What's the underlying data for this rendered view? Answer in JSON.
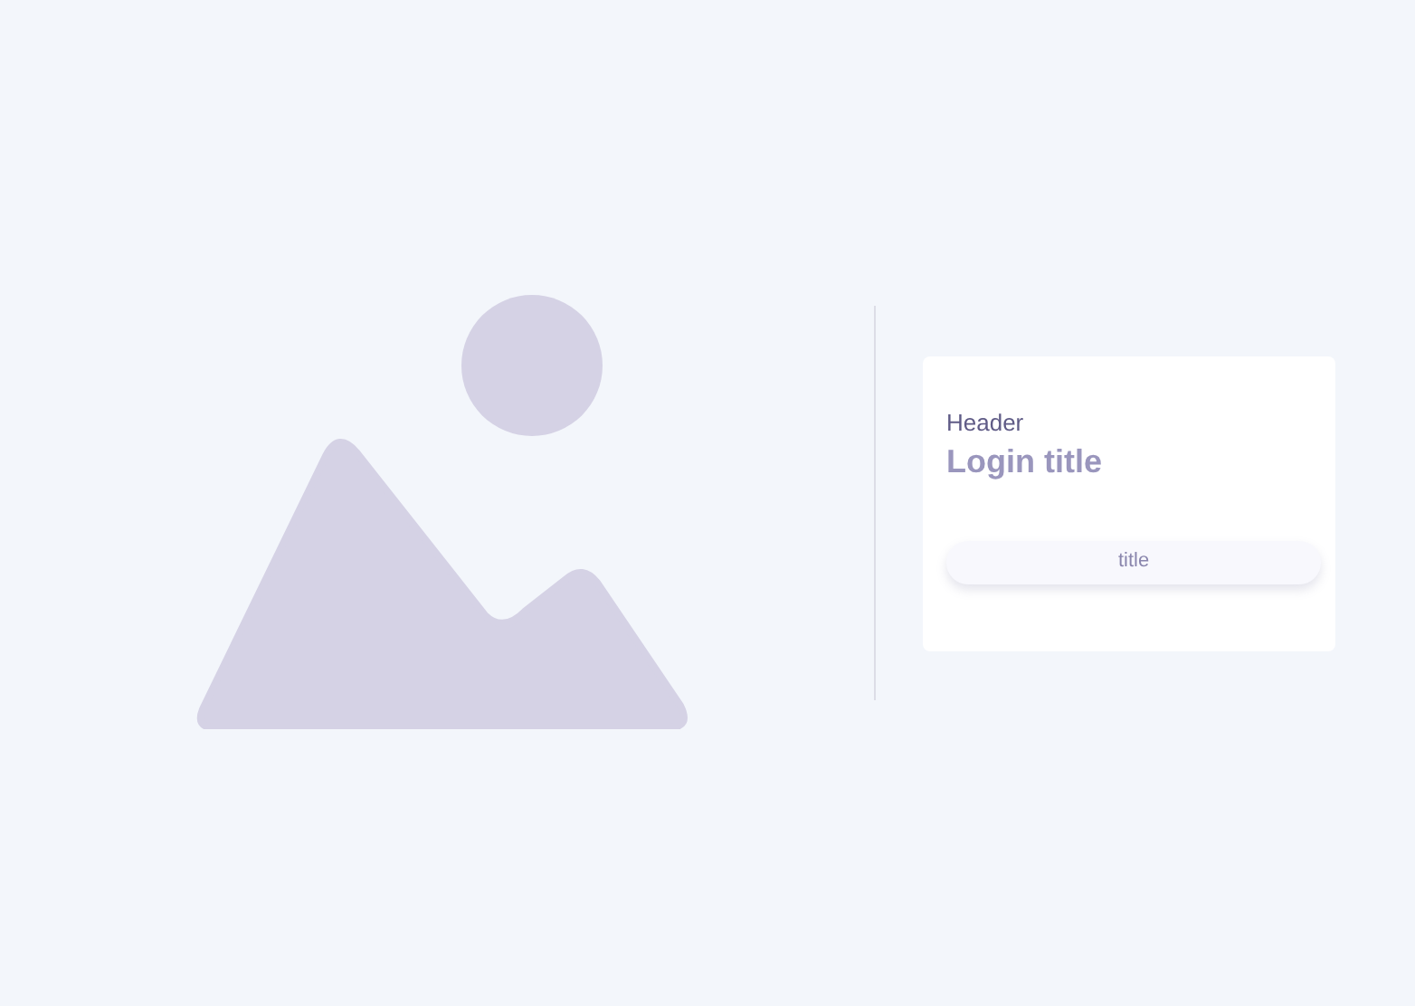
{
  "card": {
    "header": "Header",
    "title": "Login title",
    "button": "title"
  }
}
